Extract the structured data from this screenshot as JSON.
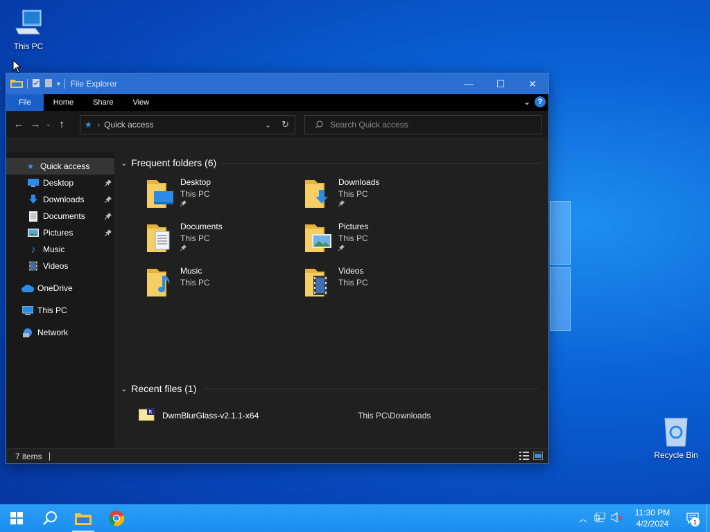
{
  "desktop": {
    "icons": [
      {
        "label": "This PC"
      },
      {
        "label": "Recycle Bin"
      }
    ]
  },
  "window": {
    "title": "File Explorer",
    "ribbon_tabs": [
      "File",
      "Home",
      "Share",
      "View"
    ],
    "address": "Quick access",
    "search_placeholder": "Search Quick access",
    "status": "7 items"
  },
  "sidebar": {
    "items": [
      {
        "label": "Quick access",
        "icon": "star-icon"
      },
      {
        "label": "Desktop",
        "icon": "desktop-icon"
      },
      {
        "label": "Downloads",
        "icon": "downloads-icon"
      },
      {
        "label": "Documents",
        "icon": "documents-icon"
      },
      {
        "label": "Pictures",
        "icon": "pictures-icon"
      },
      {
        "label": "Music",
        "icon": "music-icon"
      },
      {
        "label": "Videos",
        "icon": "videos-icon"
      },
      {
        "label": "OneDrive",
        "icon": "cloud-icon"
      },
      {
        "label": "This PC",
        "icon": "computer-icon"
      },
      {
        "label": "Network",
        "icon": "network-icon"
      }
    ]
  },
  "frequent": {
    "heading": "Frequent folders (6)",
    "folders": [
      {
        "name": "Desktop",
        "location": "This PC"
      },
      {
        "name": "Downloads",
        "location": "This PC"
      },
      {
        "name": "Documents",
        "location": "This PC"
      },
      {
        "name": "Pictures",
        "location": "This PC"
      },
      {
        "name": "Music",
        "location": "This PC"
      },
      {
        "name": "Videos",
        "location": "This PC"
      }
    ]
  },
  "recent": {
    "heading": "Recent files (1)",
    "files": [
      {
        "name": "DwmBlurGlass-v2.1.1-x64",
        "path": "This PC\\Downloads"
      }
    ]
  },
  "taskbar": {
    "time": "11:30 PM",
    "date": "4/2/2024",
    "notification_count": "1"
  },
  "colors": {
    "accent": "#2b6ed1",
    "file_tab": "#1a5fc7",
    "explorer_bg": "#202020",
    "taskbar": "#1d8ef0"
  }
}
